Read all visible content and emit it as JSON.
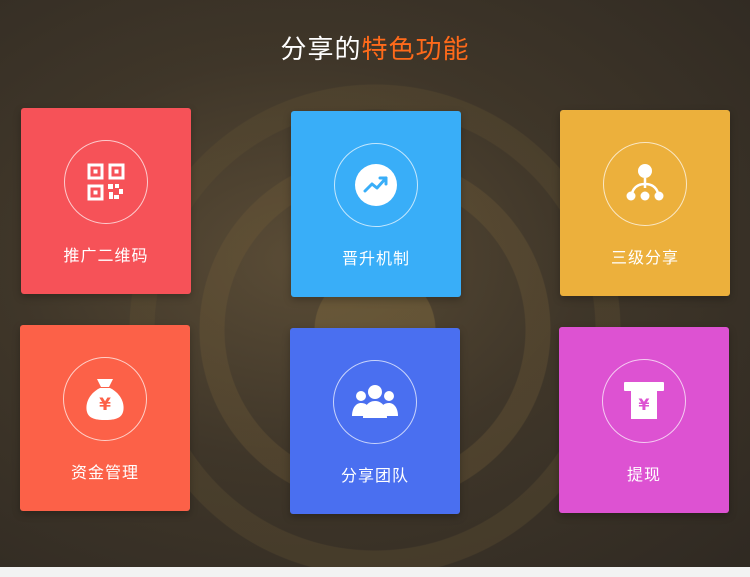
{
  "header": {
    "title_prefix": "分享的",
    "title_highlight": "特色功能"
  },
  "features": [
    {
      "label": "推广二维码",
      "icon": "qr-code-icon",
      "color": "#f65258"
    },
    {
      "label": "晋升机制",
      "icon": "trend-up-icon",
      "color": "#39aef8"
    },
    {
      "label": "三级分享",
      "icon": "hierarchy-icon",
      "color": "#ecb03c"
    },
    {
      "label": "资金管理",
      "icon": "money-bag-icon",
      "color": "#fc6148"
    },
    {
      "label": "分享团队",
      "icon": "team-icon",
      "color": "#4a6ff0"
    },
    {
      "label": "提现",
      "icon": "withdraw-icon",
      "color": "#dd52d2"
    }
  ],
  "money_symbol": "¥"
}
